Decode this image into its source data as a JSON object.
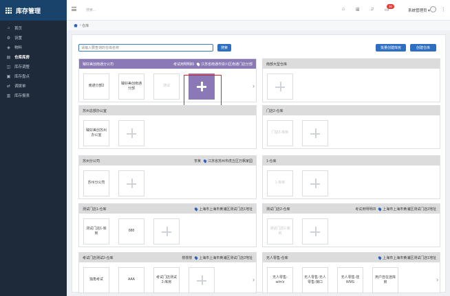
{
  "app": {
    "title": "库存管理"
  },
  "sidebar": {
    "items": [
      {
        "label": "首页",
        "icon": "home-icon"
      },
      {
        "label": "设置",
        "icon": "gear-icon"
      },
      {
        "label": "物料",
        "icon": "cube-icon"
      },
      {
        "label": "仓库库房",
        "icon": "warehouse-icon"
      },
      {
        "label": "库存调整",
        "icon": "adjust-icon"
      },
      {
        "label": "库存盘点",
        "icon": "clipboard-icon"
      },
      {
        "label": "调拨单",
        "icon": "transfer-icon"
      },
      {
        "label": "库存报表",
        "icon": "chart-icon"
      }
    ],
    "active_index": 3
  },
  "topbar": {
    "search_placeholder": "搜索...",
    "notification_count": "30",
    "user_name": "系统管理员"
  },
  "breadcrumb": {
    "current": "仓库"
  },
  "toolbar": {
    "search_placeholder": "请输入要查询的仓库名称",
    "search_label": "搜索",
    "batch_create_label": "批量创建库房",
    "create_warehouse_label": "创建仓库"
  },
  "warehouses": [
    {
      "name": "臻好美创南通分公司",
      "manager": "考试用明明四",
      "address": "江苏省南通市崇川区南通门店分部",
      "subs": [
        {
          "label": "南通分部2"
        },
        {
          "label": "臻好美创南通分部"
        },
        {
          "label": "测试",
          "dim": true
        }
      ],
      "scroll": "›"
    },
    {
      "name": "南部大型仓库",
      "subs": []
    },
    {
      "name": "苏州总部办公室",
      "subs": [
        {
          "label": "臻好美创苏州办公室"
        }
      ]
    },
    {
      "name": "门店2-仓库",
      "subs": [
        {
          "label": "门店2-库房",
          "dim": true
        }
      ]
    },
    {
      "name": "苏州分公司",
      "manager": "李某",
      "address": "江苏省苏州市虎丘区万枫家园",
      "subs": [
        {
          "label": "苏州分公司"
        }
      ]
    },
    {
      "name": "1-仓库",
      "subs": [
        {
          "label": "1-库房",
          "dim": true
        }
      ]
    },
    {
      "name": "测试门店1-仓库",
      "address": "上海市上海市黄浦区测试门店1地址",
      "subs": [
        {
          "label": "测试门店1-库房"
        },
        {
          "label": "888"
        }
      ]
    },
    {
      "name": "测试门店2-仓库",
      "manager": "考试用明明四",
      "address": "上海市上海市黄浦区测试门店2地址",
      "subs": [
        {
          "label": "测试门店2-库房",
          "dim": true
        }
      ]
    },
    {
      "name": "考试门店测试2-仓库",
      "manager": "楼楼楼",
      "address": "上海市上海市黄浦区测试门店2地址",
      "subs": [
        {
          "label": "独角考试"
        },
        {
          "label": "AAA"
        },
        {
          "label": "考试门店测试2-库房"
        }
      ],
      "scroll": "›"
    },
    {
      "name": "无人零售-仓库",
      "address": "上海市上海市黄浦区测试门店1地址",
      "subs": [
        {
          "label": "无人零售-w/m's"
        },
        {
          "label": "无人零售-无人零售-接口"
        },
        {
          "label": "无人零售-挂WMS"
        },
        {
          "label": "用户自在途库房"
        }
      ],
      "scroll": "›"
    }
  ]
}
